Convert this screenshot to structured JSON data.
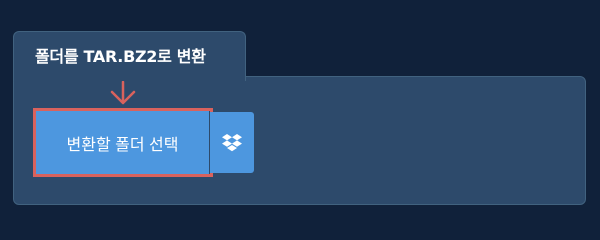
{
  "converter": {
    "tab_title": "폴더를 TAR.BZ2로 변환",
    "select_folder_label": "변환할 폴더 선택",
    "dropbox_icon": "dropbox-icon",
    "arrow_icon": "arrow-down-icon"
  },
  "colors": {
    "page_background": "#10213a",
    "panel_background": "#2d4a6b",
    "button_background": "#4d97df",
    "highlight": "#d9625d"
  }
}
